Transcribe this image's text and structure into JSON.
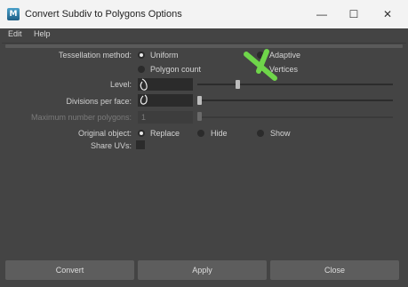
{
  "window": {
    "app_icon_letter": "M",
    "title": "Convert Subdiv to Polygons Options",
    "minimize_glyph": "—",
    "maximize_glyph": "☐",
    "close_glyph": "✕"
  },
  "menu": {
    "edit": "Edit",
    "help": "Help"
  },
  "tessellation": {
    "label": "Tessellation method:",
    "options": [
      "Uniform",
      "Adaptive",
      "Polygon count",
      "Vertices"
    ],
    "selected": "Uniform"
  },
  "level": {
    "label": "Level:",
    "value": "",
    "slider_fraction": 0.21
  },
  "divisions": {
    "label": "Divisions per face:",
    "value": "",
    "slider_fraction": 0.0
  },
  "max_polygons": {
    "label": "Maximum number polygons:",
    "value": "1",
    "slider_fraction": 0.0,
    "enabled": false
  },
  "original_object": {
    "label": "Original object:",
    "options": [
      "Replace",
      "Hide",
      "Show"
    ],
    "selected": "Replace"
  },
  "share_uvs": {
    "label": "Share UVs:",
    "checked": false
  },
  "buttons": {
    "convert": "Convert",
    "apply": "Apply",
    "close": "Close"
  },
  "colors": {
    "background": "#444444",
    "field": "#2b2b2b",
    "button": "#5d5d5d",
    "titlebar": "#f3f3f3",
    "annotation_green": "#6fd64a"
  }
}
